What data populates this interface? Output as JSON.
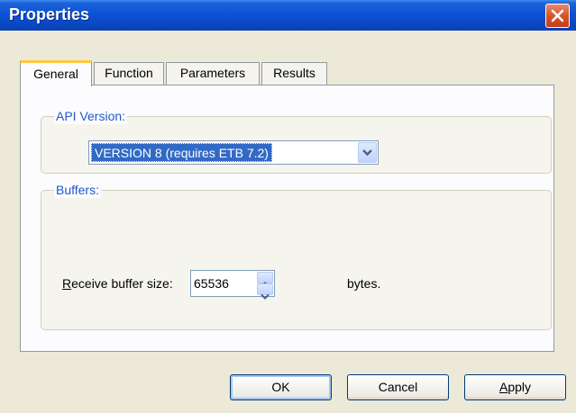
{
  "window": {
    "title": "Properties"
  },
  "tabs": [
    {
      "label": "General",
      "active": true
    },
    {
      "label": "Function",
      "active": false
    },
    {
      "label": "Parameters",
      "active": false
    },
    {
      "label": "Results",
      "active": false
    }
  ],
  "api_version": {
    "group_label": "API Version:",
    "selected": "VERSION 8 (requires ETB 7.2)"
  },
  "buffers": {
    "group_label": "Buffers:",
    "receive_label_mnemonic": "R",
    "receive_label_rest": "eceive buffer size:",
    "receive_value": "65536",
    "unit": "bytes."
  },
  "buttons": {
    "ok": "OK",
    "cancel": "Cancel",
    "apply_mnemonic": "A",
    "apply_rest": "pply"
  },
  "colors": {
    "title_bar": "#0a48c2",
    "group_label": "#2158c6",
    "selection": "#316ac5",
    "close": "#d2512b"
  },
  "icons": {
    "close": "close-icon",
    "dropdown": "chevron-down-icon",
    "spin_up": "arrow-up-icon",
    "spin_down": "arrow-down-icon"
  }
}
